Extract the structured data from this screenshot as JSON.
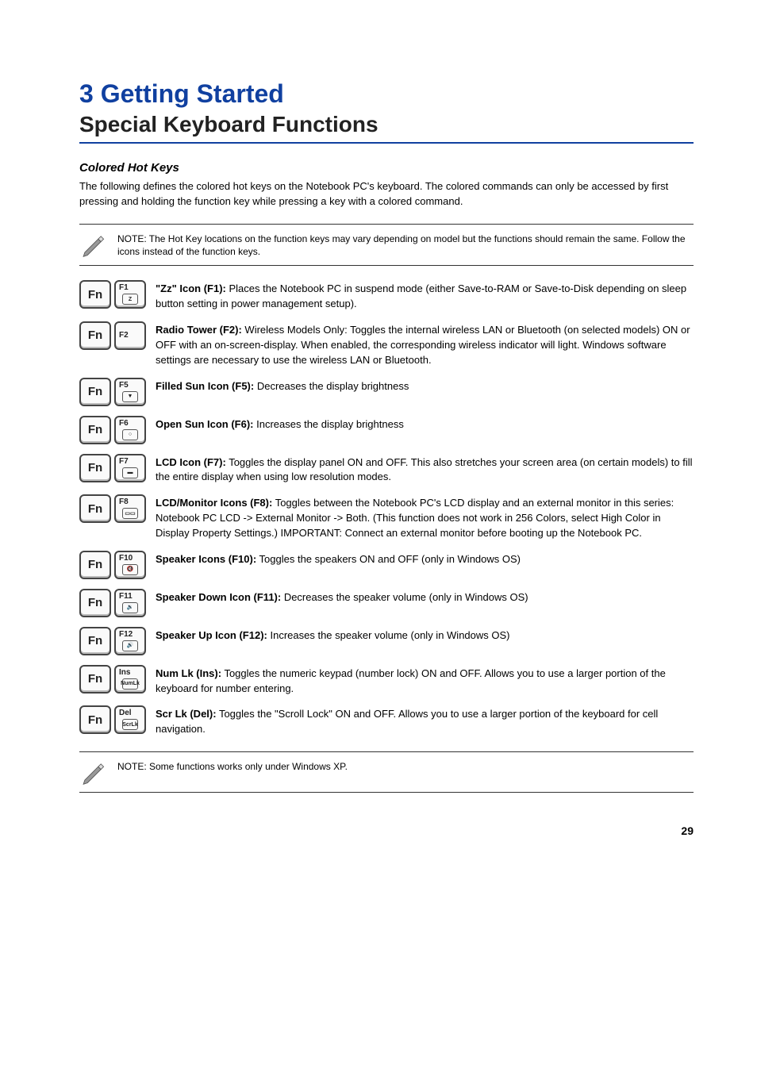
{
  "chapter": {
    "title": "3 Getting Started",
    "subtitle": "Special Keyboard Functions"
  },
  "sections": {
    "colored_label": "Colored Hot Keys",
    "colored_intro": "The following defines the colored hot keys on the Notebook PC's keyboard. The colored commands can only be accessed by first pressing and holding the function key while pressing a key with a colored command."
  },
  "notes": {
    "note1": "NOTE: The Hot Key locations on the function keys may vary depending on model but the functions should remain the same. Follow the icons instead of the function keys.",
    "note2": "NOTE: Some functions works only under Windows XP."
  },
  "hotkeys": [
    {
      "combo": [
        "Fn",
        "F1"
      ],
      "sub": "Z",
      "label": "\"Zz\" Icon (F1):",
      "desc": " Places the Notebook PC in suspend mode (either Save-to-RAM or Save-to-Disk depending on sleep button setting in power management setup)."
    },
    {
      "combo": [
        "Fn",
        "F2"
      ],
      "sub": "",
      "label": "Radio Tower (F2):",
      "desc": " Wireless Models Only: Toggles the internal wireless LAN or Bluetooth (on selected models) ON or OFF with an on-screen-display. When enabled, the corresponding wireless indicator will light. Windows software settings are necessary to use the wireless LAN or Bluetooth."
    },
    {
      "combo": [
        "Fn",
        "F5"
      ],
      "sub": "▼",
      "label": "Filled Sun Icon (F5):",
      "desc": " Decreases the display brightness"
    },
    {
      "combo": [
        "Fn",
        "F6"
      ],
      "sub": "○",
      "label": "Open Sun Icon (F6):",
      "desc": " Increases the display brightness"
    },
    {
      "combo": [
        "Fn",
        "F7"
      ],
      "sub": "▬",
      "label": "LCD Icon (F7):",
      "desc": " Toggles the display panel ON and OFF. This also stretches your screen area (on certain models) to fill the entire display when using low resolution modes."
    },
    {
      "combo": [
        "Fn",
        "F8"
      ],
      "sub": "▭▭",
      "label": "LCD/Monitor Icons (F8):",
      "desc": " Toggles between the Notebook PC's LCD display and an external monitor in this series: Notebook PC LCD -> External Monitor -> Both. (This function does not work in 256 Colors, select High Color in Display Property Settings.) IMPORTANT: Connect an external monitor before booting up the Notebook PC."
    },
    {
      "combo": [
        "Fn",
        "F10"
      ],
      "sub": "🔇",
      "label": "Speaker Icons (F10):",
      "desc": " Toggles the speakers ON and OFF (only in Windows OS)"
    },
    {
      "combo": [
        "Fn",
        "F11"
      ],
      "sub": "🔉",
      "label": "Speaker Down Icon (F11):",
      "desc": " Decreases the speaker volume (only in Windows OS)"
    },
    {
      "combo": [
        "Fn",
        "F12"
      ],
      "sub": "🔊",
      "label": "Speaker Up Icon (F12):",
      "desc": " Increases the speaker volume (only in Windows OS)"
    },
    {
      "combo": [
        "Fn",
        "Ins"
      ],
      "sub": "NumLk",
      "label": "Num Lk (Ins):",
      "desc": " Toggles the numeric keypad (number lock) ON and OFF. Allows you to use a larger portion of the keyboard for number entering."
    },
    {
      "combo": [
        "Fn",
        "Del"
      ],
      "sub": "ScrLk",
      "label": "Scr Lk (Del):",
      "desc": " Toggles the \"Scroll Lock\" ON and OFF. Allows you to use a larger portion of the keyboard for cell navigation."
    }
  ],
  "page_number": "29"
}
